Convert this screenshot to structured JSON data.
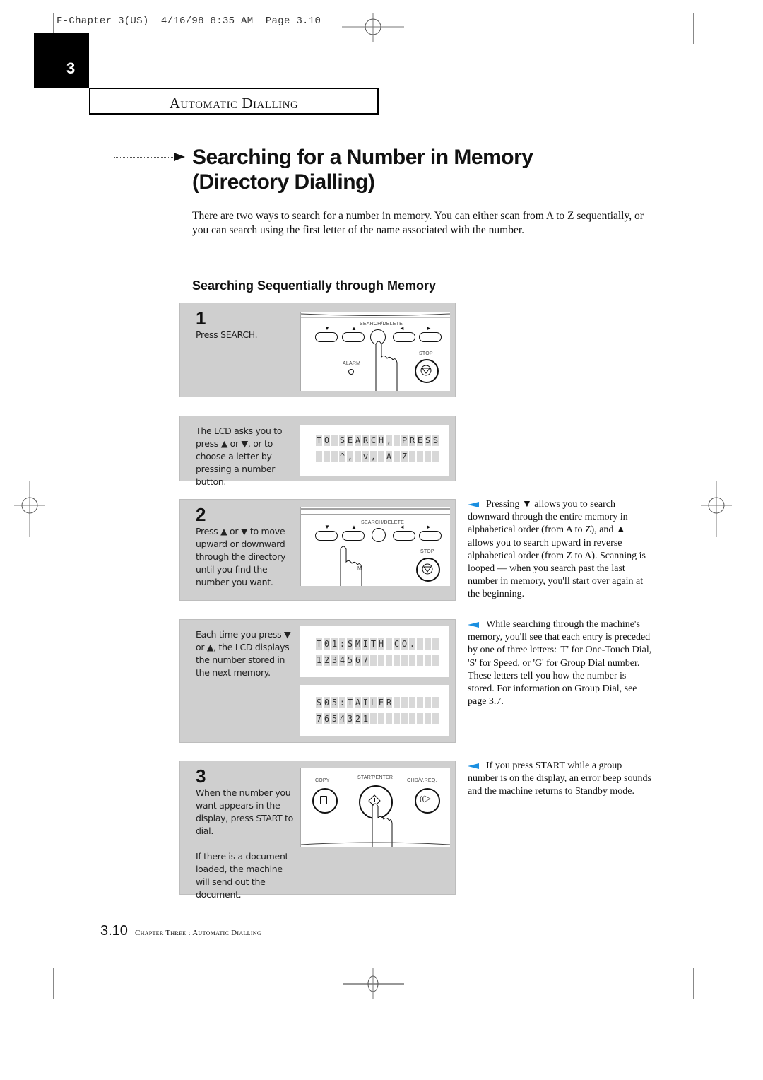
{
  "print_header": "F-Chapter 3(US)  4/16/98 8:35 AM  Page 3.10",
  "chapter_number": "3",
  "section_title": "Automatic Dialling",
  "main_title_line1": "Searching for a Number in Memory",
  "main_title_line2": "(Directory Dialling)",
  "intro": "There are two ways to search for a number in memory. You can either scan from A to Z sequentially, or you can search using the first letter of the name associated with the number.",
  "subheading": "Searching Sequentially through Memory",
  "steps": [
    {
      "number": "1",
      "text": "Press SEARCH.",
      "device": {
        "buttons": [
          "▼",
          "▲",
          "◄",
          "►"
        ],
        "search_label": "SEARCH/DELETE",
        "alarm_label": "ALARM",
        "stop_label": "STOP"
      }
    },
    {
      "lcd_intro": "The LCD asks you to press ▲ or ▼, or to choose a letter by pressing a number button.",
      "lcd_line1": "TO SEARCH, PRESS",
      "lcd_line2": "   ^, v, A-Z   "
    },
    {
      "number": "2",
      "text": "Press ▲ or ▼ to move upward or downward through the directory until you find the number you want.",
      "device": {
        "search_label": "SEARCH/DELETE",
        "stop_label": "STOP",
        "finger_label": "M"
      }
    },
    {
      "lcd_intro": "Each time you press ▼ or ▲, the LCD displays the number stored in the next memory.",
      "displays": [
        {
          "line1": "T01:SMITH CO.   ",
          "line2": "1234567         "
        },
        {
          "line1": "S05:TAILER      ",
          "line2": "7654321         "
        }
      ]
    },
    {
      "number": "3",
      "text": "When the number you want appears in the display, press START to dial.",
      "text2": "If there is a document loaded, the machine will send out the document.",
      "device": {
        "copy_label": "COPY",
        "start_label": "START/ENTER",
        "ohd_label": "OHD/V.REQ."
      }
    }
  ],
  "notes": [
    "Pressing ▼ allows you to search downward through the entire memory in alphabetical order (from A to Z), and ▲ allows you to search upward in reverse alphabetical order (from Z to A). Scanning is looped — when you search past the last number in memory, you'll start over again at the beginning.",
    "While searching through the machine's memory, you'll see that each entry is preceded by one of three letters: 'T' for One-Touch Dial, 'S' for Speed,  or 'G' for Group Dial number. These letters tell you how the number is stored. For information on Group Dial, see page 3.7.",
    "If you press START while a group number is on the display, an error beep sounds and the machine returns to Standby mode."
  ],
  "footer": {
    "page": "3.10",
    "text": "Chapter Three : Automatic Dialling"
  },
  "colors": {
    "panel_bg": "#cfcfcf",
    "note_arrow": "#1b8fe0",
    "chapter_block": "#000000"
  }
}
